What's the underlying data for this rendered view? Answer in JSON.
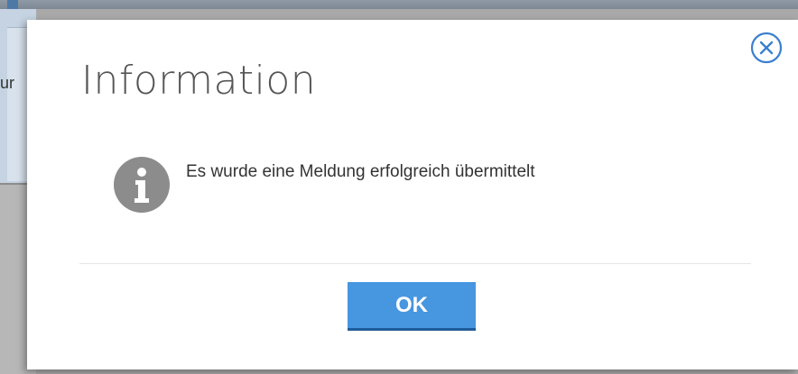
{
  "background": {
    "partial_text": "ur"
  },
  "dialog": {
    "title": "Information",
    "message": "Es wurde eine Meldung erfolgreich übermittelt",
    "ok_label": "OK",
    "close_icon": "close-icon",
    "info_icon": "info-icon"
  },
  "colors": {
    "accent": "#4796e0",
    "accent_border": "#1f5c9a",
    "close_icon": "#3b7fcf",
    "info_icon": "#8c8c8c",
    "title_text": "#555555"
  }
}
